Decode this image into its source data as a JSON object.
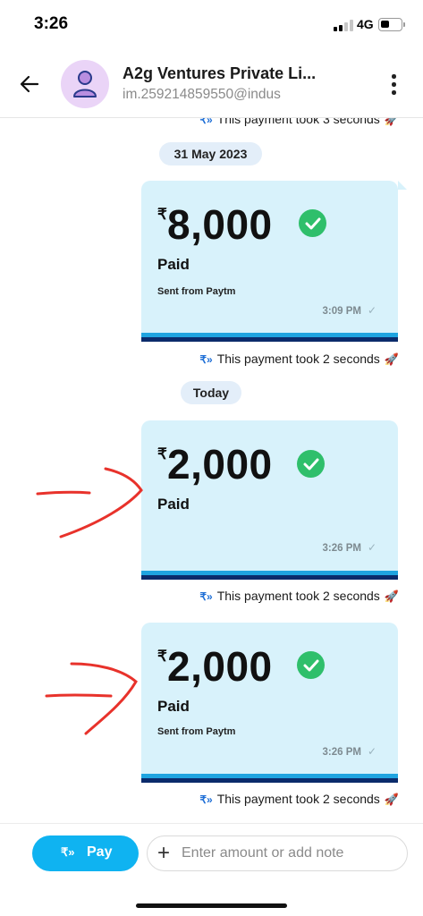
{
  "status_bar": {
    "time": "3:26",
    "network": "4G",
    "signal_bars_on": 2,
    "signal_bars_total": 4,
    "battery_level": 0.45
  },
  "header": {
    "back_icon": "back-arrow-icon",
    "avatar_icon": "user-icon",
    "name": "A2g Ventures Private Li...",
    "upi_id": "im.259214859550@indus",
    "menu_icon": "more-vertical-icon"
  },
  "chat": {
    "top_partial_note": "This payment took 3 seconds",
    "dates": [
      "31 May 2023",
      "Today"
    ],
    "payments": [
      {
        "currency": "₹",
        "amount": "8,000",
        "status": "Paid",
        "sent_from": "Sent from Paytm",
        "time": "3:09 PM",
        "note": "This payment took 2 seconds"
      },
      {
        "currency": "₹",
        "amount": "2,000",
        "status": "Paid",
        "sent_from": "",
        "time": "3:26 PM",
        "note": "This payment took 2 seconds"
      },
      {
        "currency": "₹",
        "amount": "2,000",
        "status": "Paid",
        "sent_from": "Sent from Paytm",
        "time": "3:26 PM",
        "note": "This payment took 2 seconds"
      }
    ],
    "note_icon": "rupee-transfer-icon",
    "rocket_icon": "rocket-icon",
    "annotation_color": "#e8322b"
  },
  "composer": {
    "pay_label": "Pay",
    "pay_icon": "rupee-send-icon",
    "plus_icon": "plus-icon",
    "input_placeholder": "Enter amount or add note"
  },
  "colors": {
    "accent": "#0fb3f1",
    "card_bg": "#d8f2fb",
    "success": "#2fbf6b",
    "card_stripe_dark": "#0b2b6b",
    "card_stripe_light": "#1fa4e0"
  }
}
